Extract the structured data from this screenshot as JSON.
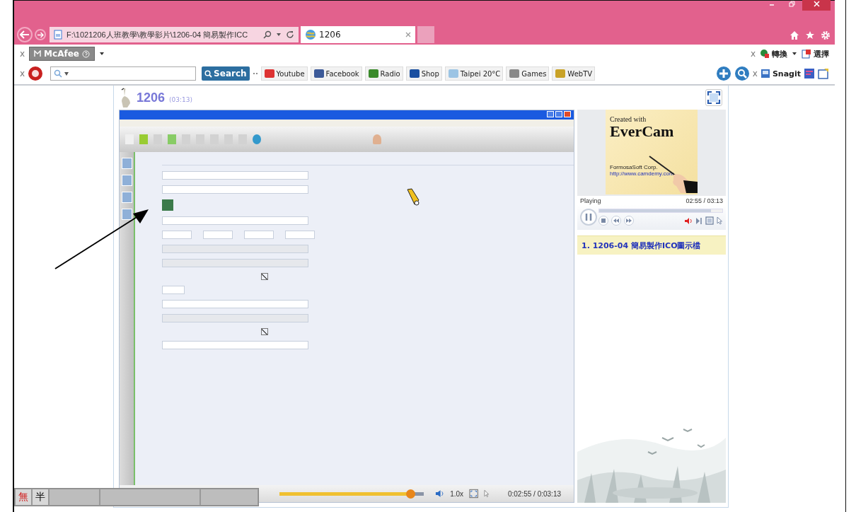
{
  "browser": {
    "address": "F:\\1021206人班教學\\教學影片\\1206-04 簡易製作ICC",
    "tabs": [
      {
        "label": "1206",
        "selected": true
      }
    ],
    "toolbar_1": {
      "close_mark": "x",
      "mcafee": "McAfee",
      "right_close_mark": "x",
      "convert": "轉換",
      "select": "選擇"
    },
    "toolbar_2": {
      "close_mark": "x",
      "search_button": "Search",
      "bookmarks": [
        {
          "label": "Youtube",
          "kind": "youtube"
        },
        {
          "label": "Facebook",
          "kind": "facebook"
        },
        {
          "label": "Radio",
          "kind": "radio"
        },
        {
          "label": "Shop",
          "kind": "shop"
        },
        {
          "label": "Taipei 20°C",
          "kind": "weather"
        },
        {
          "label": "Games",
          "kind": "games"
        },
        {
          "label": "WebTV",
          "kind": "tv"
        }
      ],
      "right_close_mark": "x",
      "snagit": "Snagit"
    }
  },
  "player": {
    "title": "1206",
    "duration": "(03:13)",
    "video": {
      "level": 0.907,
      "form_checkboxes": [
        {
          "checked": true
        },
        {
          "checked": true
        }
      ],
      "speed": "1.0x",
      "time": "0:02:55 / 0:03:13"
    },
    "poster": {
      "line_1": "Created with",
      "line_2": "EverCam",
      "line_3": "FormosaSoft Corp.",
      "line_4": "http://www.camdemy.com"
    },
    "status": "Playing",
    "time": "02:55 / 03:13",
    "level": 0.907,
    "playlist": [
      {
        "label": "1. 1206-04 簡易製作ICO圖示檔",
        "selected": true
      }
    ]
  },
  "ime": {
    "mode": "無",
    "width": "半"
  }
}
